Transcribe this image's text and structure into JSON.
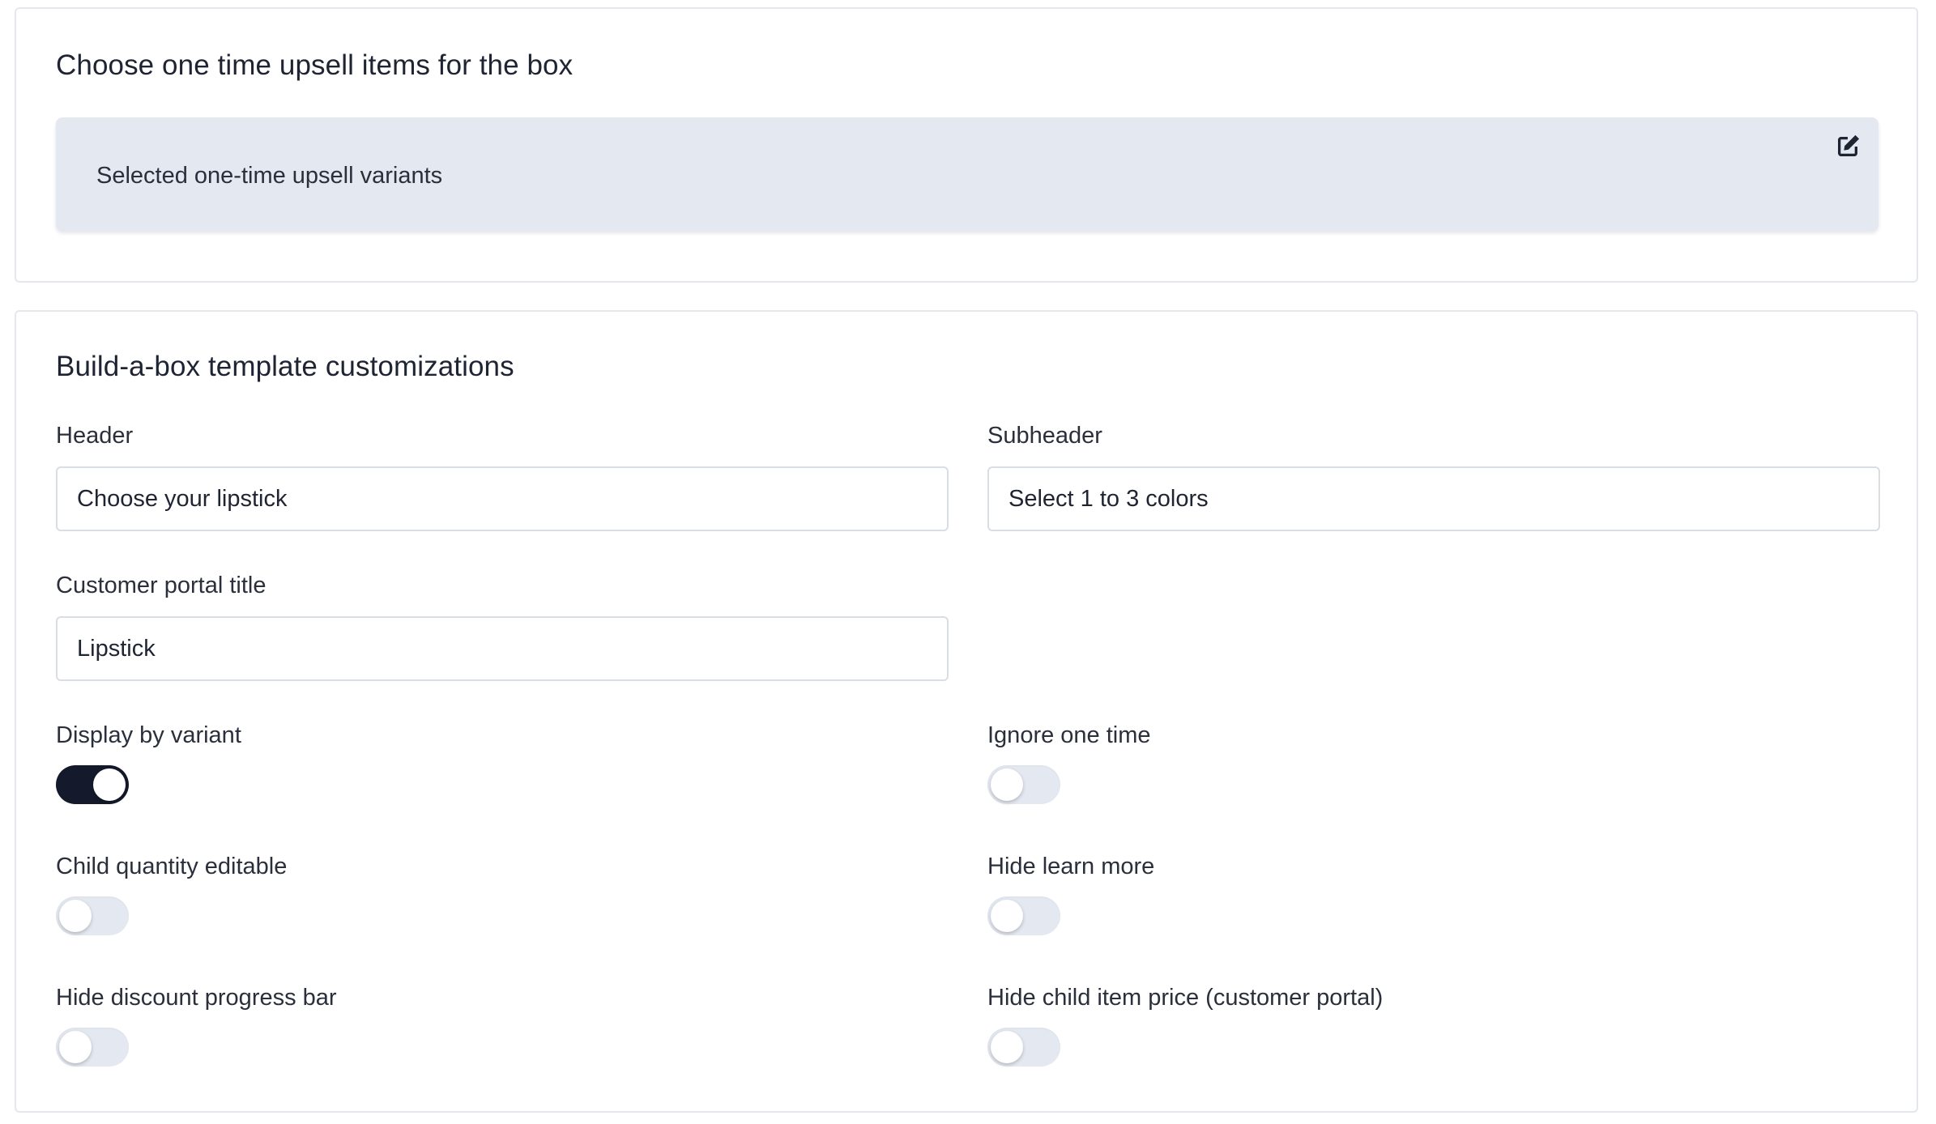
{
  "upsell_card": {
    "title": "Choose one time upsell items for the box",
    "panel_label": "Selected one-time upsell variants",
    "edit_icon": "edit-icon"
  },
  "customizations_card": {
    "title": "Build-a-box template customizations",
    "header": {
      "label": "Header",
      "value": "Choose your lipstick"
    },
    "subheader": {
      "label": "Subheader",
      "value": "Select 1 to 3 colors"
    },
    "portal_title": {
      "label": "Customer portal title",
      "value": "Lipstick"
    },
    "toggles": {
      "display_by_variant": {
        "label": "Display by variant",
        "on": true
      },
      "ignore_one_time": {
        "label": "Ignore one time",
        "on": false
      },
      "child_quantity_editable": {
        "label": "Child quantity editable",
        "on": false
      },
      "hide_learn_more": {
        "label": "Hide learn more",
        "on": false
      },
      "hide_discount_progress_bar": {
        "label": "Hide discount progress bar",
        "on": false
      },
      "hide_child_item_price": {
        "label": "Hide child item price (customer portal)",
        "on": false
      }
    }
  },
  "colors": {
    "panel_bg": "#e3e8f1",
    "toggle_on": "#141a2b",
    "toggle_off": "#e4e8f0",
    "border": "#d9dde4"
  }
}
